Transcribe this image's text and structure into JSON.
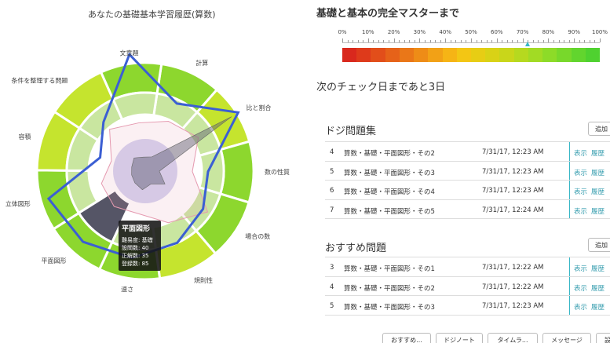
{
  "radar": {
    "title": "あなたの基礎基本学習履歴(算数)",
    "categories": [
      "計算",
      "比と割合",
      "数の性質",
      "場合の数",
      "規則性",
      "速さ",
      "平面図形",
      "立体図形",
      "容積",
      "条件を整理する問題",
      "文章題"
    ],
    "palette": {
      "outer_ring": "#8dd72e",
      "bright_segment": "#c5e42e",
      "inner_ring": "#c9e6a0",
      "center": "#d4d2ef",
      "blue_line": "#3b5fd3",
      "pink_line": "#e59ab0",
      "dark_fill": "#555566"
    }
  },
  "tooltip": {
    "title": "平面図形",
    "lines": [
      "難易度: 基礎",
      "設問数: 40",
      "正解数: 35",
      "登録数: 85"
    ]
  },
  "mastery": {
    "title": "基礎と基本の完全マスターまで",
    "scale_labels": [
      "0%",
      "10%",
      "20%",
      "30%",
      "40%",
      "50%",
      "60%",
      "70%",
      "80%",
      "90%",
      "100%"
    ],
    "progress_percent": 72,
    "marker_color": "#38b7c6",
    "gradient_colors": [
      "#d9281d",
      "#de3a1b",
      "#e24e1a",
      "#e66219",
      "#ea7718",
      "#ee8c17",
      "#f2a116",
      "#f6b415",
      "#f3c614",
      "#e7cd14",
      "#d9d216",
      "#c9d61a",
      "#b6d91f",
      "#a2db24",
      "#8ddb28",
      "#78d82b",
      "#62d52e",
      "#4fd130"
    ]
  },
  "next_check": "次のチェック日まであと3日",
  "doji": {
    "title": "ドジ問題集",
    "add_label": "追加",
    "rows": [
      {
        "num": "4",
        "name": "算数・基礎・平面図形・その2",
        "date": "7/31/17, 12:23 AM",
        "show": "表示",
        "history": "履歴"
      },
      {
        "num": "5",
        "name": "算数・基礎・平面図形・その3",
        "date": "7/31/17, 12:23 AM",
        "show": "表示",
        "history": "履歴"
      },
      {
        "num": "6",
        "name": "算数・基礎・平面図形・その4",
        "date": "7/31/17, 12:23 AM",
        "show": "表示",
        "history": "履歴"
      },
      {
        "num": "7",
        "name": "算数・基礎・平面図形・その5",
        "date": "7/31/17, 12:24 AM",
        "show": "表示",
        "history": "履歴"
      }
    ]
  },
  "recommended": {
    "title": "おすすめ問題",
    "add_label": "追加",
    "rows": [
      {
        "num": "3",
        "name": "算数・基礎・平面図形・その1",
        "date": "7/31/17, 12:22 AM",
        "show": "表示",
        "history": "履歴"
      },
      {
        "num": "4",
        "name": "算数・基礎・平面図形・その2",
        "date": "7/31/17, 12:22 AM",
        "show": "表示",
        "history": "履歴"
      },
      {
        "num": "5",
        "name": "算数・基礎・平面図形・その3",
        "date": "7/31/17, 12:23 AM",
        "show": "表示",
        "history": "履歴"
      }
    ]
  },
  "bottom_buttons": [
    "おすすめ...",
    "ドジノート",
    "タイムラ...",
    "メッセージ",
    "設"
  ]
}
